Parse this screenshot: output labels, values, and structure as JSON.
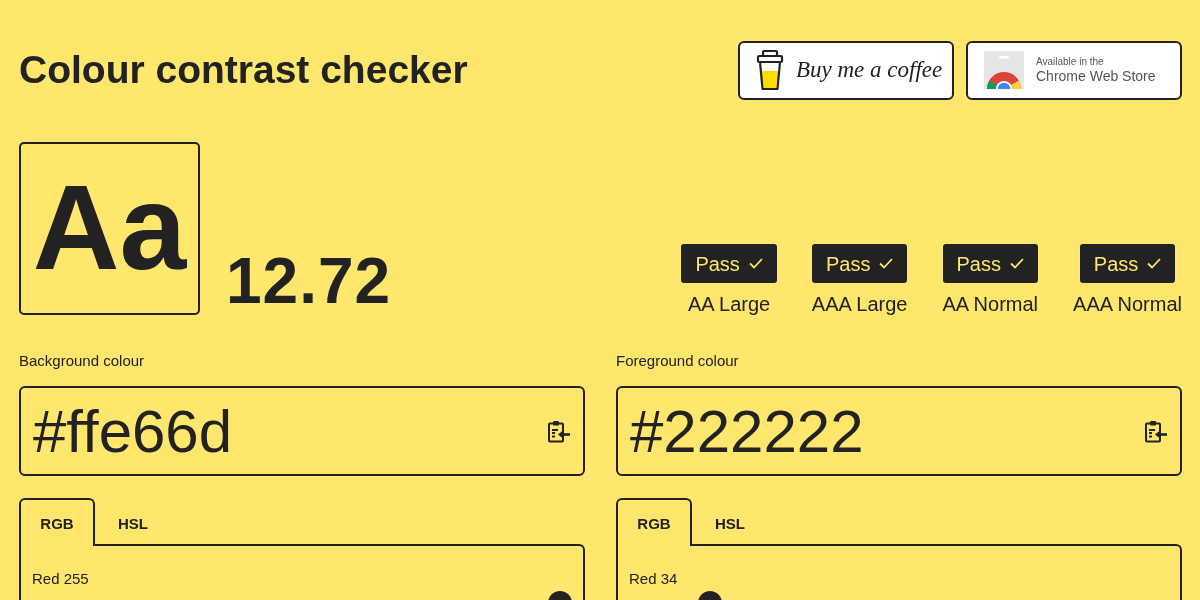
{
  "header": {
    "title": "Colour contrast checker",
    "links": [
      {
        "kind": "coffee",
        "label": "Buy me a coffee"
      },
      {
        "kind": "store",
        "caption": "Available in the",
        "label": "Chrome Web Store"
      }
    ]
  },
  "preview": {
    "sample": "Aa",
    "ratio": "12.72"
  },
  "checks": [
    {
      "status": "Pass",
      "passed": true,
      "label": "AA Large"
    },
    {
      "status": "Pass",
      "passed": true,
      "label": "AAA Large"
    },
    {
      "status": "Pass",
      "passed": true,
      "label": "AA Normal"
    },
    {
      "status": "Pass",
      "passed": true,
      "label": "AAA Normal"
    }
  ],
  "colours": [
    {
      "label": "Background colour",
      "value": "#ffe66d",
      "tabs": [
        {
          "label": "RGB",
          "selected": true
        },
        {
          "label": "HSL",
          "selected": false
        }
      ],
      "sliders": [
        {
          "label": "Red 255",
          "level": 1
        }
      ]
    },
    {
      "label": "Foreground colour",
      "value": "#222222",
      "tabs": [
        {
          "label": "RGB",
          "selected": true
        },
        {
          "label": "HSL",
          "selected": false
        }
      ],
      "sliders": [
        {
          "label": "Red 34",
          "level": 0.133
        }
      ]
    }
  ]
}
